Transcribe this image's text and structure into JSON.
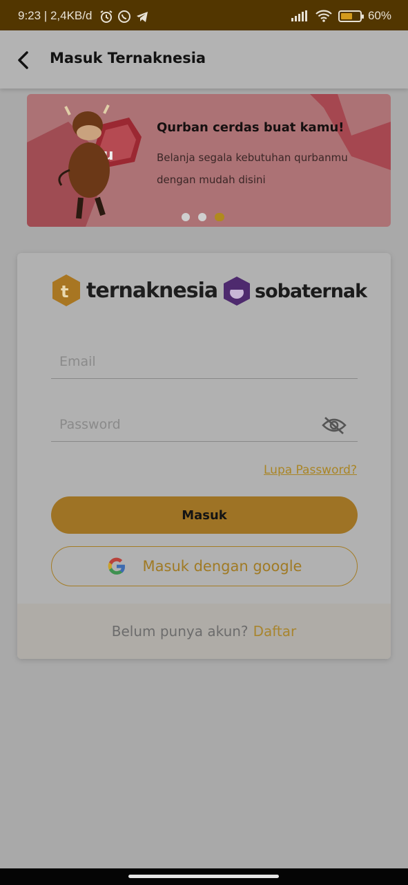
{
  "status_bar": {
    "time": "9:23 | 2,4KB/d",
    "battery": "60%",
    "battery_level": 0.6
  },
  "app_bar": {
    "back_icon": "back-arrow-icon",
    "title": "Masuk Ternaknesia"
  },
  "banner": {
    "title": "Qurban cerdas buat kamu!",
    "subtitle": "Belanja segala kebutuhan qurbanmu dengan mudah disini",
    "dots_count": 3,
    "active_dot": 3
  },
  "logos": {
    "ternaknesia": "ternaknesia",
    "sobaternak": "sobaternak"
  },
  "login_form": {
    "email_placeholder": "Email",
    "password_placeholder": "Password",
    "forgot_password": "Lupa Password?",
    "login_button": "Masuk",
    "google_button": "Masuk dengan google"
  },
  "footer": {
    "question": "Belum punya akun?",
    "register_link": "Daftar"
  },
  "colors": {
    "accent": "#a98526",
    "status_bar": "#523600",
    "button": "#9e7325"
  }
}
